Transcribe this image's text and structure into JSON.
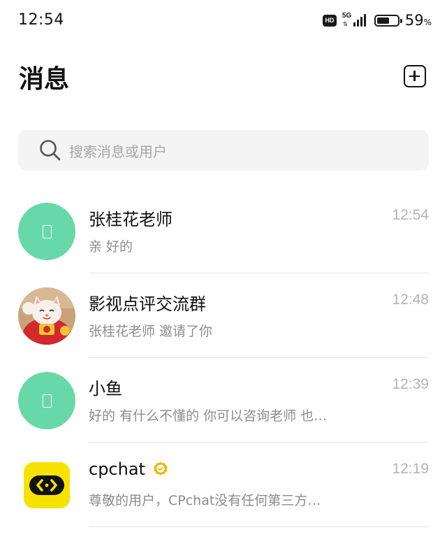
{
  "status_bar": {
    "time": "12:54",
    "hd_label": "HD",
    "network_type": "5G",
    "battery_percent": "59",
    "battery_unit": "%",
    "battery_level": 0.59
  },
  "header": {
    "title": "消息",
    "add_icon": "plus-square-icon"
  },
  "search": {
    "placeholder": "搜索消息或用户",
    "icon": "search-icon"
  },
  "conversations": [
    {
      "name": "张桂花老师",
      "preview": "亲 好的",
      "time": "12:54",
      "avatar": "default-avatar",
      "avatar_color": "#67d9a9"
    },
    {
      "name": "影视点评交流群",
      "preview": "张桂花老师 邀请了你",
      "time": "12:48",
      "avatar": "lucky-cat-photo"
    },
    {
      "name": "小鱼",
      "preview": "好的 有什么不懂的 你可以咨询老师 也…",
      "time": "12:39",
      "avatar": "default-avatar",
      "avatar_color": "#67d9a9"
    },
    {
      "name": "cpchat",
      "preview": "尊敬的用户，CPchat没有任何第三方…",
      "time": "12:19",
      "avatar": "cpchat-logo",
      "verified": true,
      "logo_color": "#f5e200"
    }
  ],
  "colors": {
    "accent_green": "#67d9a9",
    "verified_gold": "#f0b400",
    "muted_text": "#8c8c8c",
    "time_text": "#b4b4b4"
  }
}
